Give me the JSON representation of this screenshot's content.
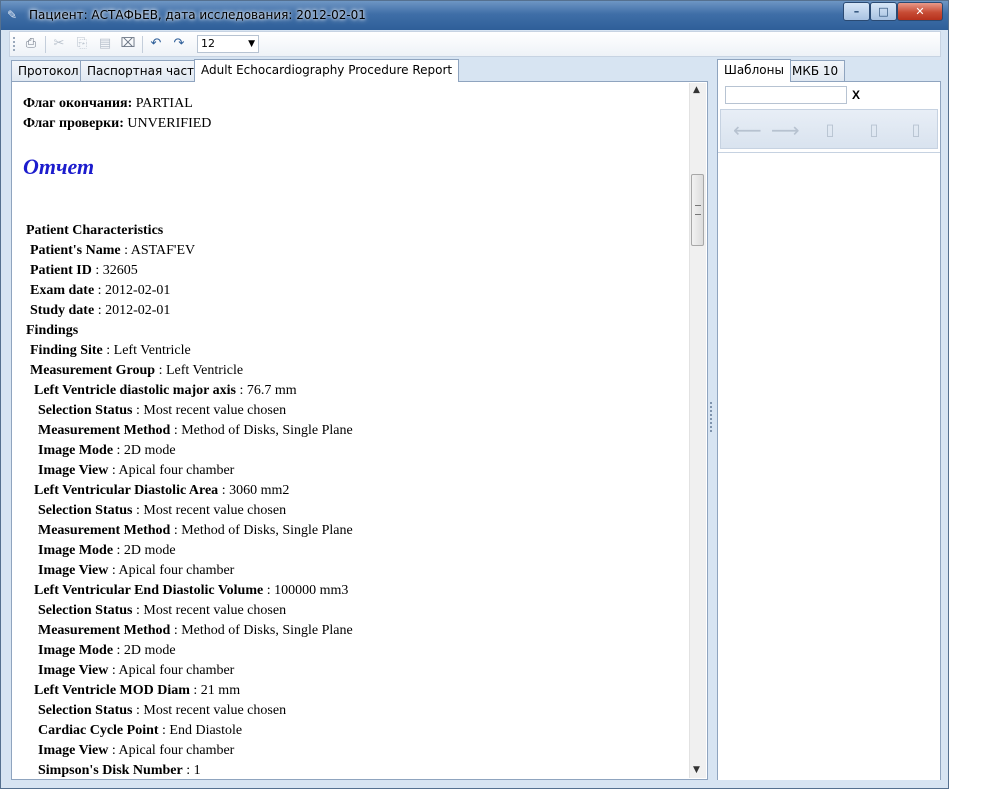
{
  "window": {
    "title": "Пациент: АСТАФЬЕВ, дата исследования: 2012-02-01",
    "minimize": "–",
    "maximize": "□",
    "close": "✕"
  },
  "toolbar": {
    "font_size": "12"
  },
  "tabs": [
    {
      "label": "Протокол",
      "active": false
    },
    {
      "label": "Паспортная часть",
      "active": false
    },
    {
      "label": "Adult Echocardiography Procedure Report",
      "active": true
    }
  ],
  "side_tabs": [
    {
      "label": "Шаблоны",
      "active": true
    },
    {
      "label": "МКБ 10",
      "active": false
    }
  ],
  "side_panel": {
    "search_value": "",
    "clear_label": "X"
  },
  "document": {
    "flags": [
      {
        "label": "Флаг окончания:",
        "value": " PARTIAL"
      },
      {
        "label": "Флаг проверки:",
        "value": " UNVERIFIED"
      }
    ],
    "heading": "Отчет",
    "lines": [
      {
        "label": "Patient Characteristics",
        "value": ""
      },
      {
        "label": "Patient's Name",
        "value": " : ASTAF'EV"
      },
      {
        "label": "Patient ID",
        "value": " : 32605"
      },
      {
        "label": "Exam date",
        "value": " : 2012-02-01"
      },
      {
        "label": "Study date",
        "value": " : 2012-02-01"
      },
      {
        "label": "Findings",
        "value": ""
      },
      {
        "label": "Finding Site",
        "value": " : Left Ventricle"
      },
      {
        "label": "Measurement Group",
        "value": " : Left Ventricle"
      },
      {
        "label": "Left Ventricle diastolic major axis",
        "value": " : 76.7 mm"
      },
      {
        "label": "Selection Status",
        "value": " : Most recent value chosen"
      },
      {
        "label": "Measurement Method",
        "value": " : Method of Disks, Single Plane"
      },
      {
        "label": "Image Mode",
        "value": " : 2D mode"
      },
      {
        "label": "Image View",
        "value": " : Apical four chamber"
      },
      {
        "label": "Left Ventricular Diastolic Area",
        "value": " : 3060 mm2"
      },
      {
        "label": "Selection Status",
        "value": " : Most recent value chosen"
      },
      {
        "label": "Measurement Method",
        "value": " : Method of Disks, Single Plane"
      },
      {
        "label": "Image Mode",
        "value": " : 2D mode"
      },
      {
        "label": "Image View",
        "value": " : Apical four chamber"
      },
      {
        "label": "Left Ventricular End Diastolic Volume",
        "value": " : 100000 mm3"
      },
      {
        "label": "Selection Status",
        "value": " : Most recent value chosen"
      },
      {
        "label": "Measurement Method",
        "value": " : Method of Disks, Single Plane"
      },
      {
        "label": "Image Mode",
        "value": " : 2D mode"
      },
      {
        "label": "Image View",
        "value": " : Apical four chamber"
      },
      {
        "label": "Left Ventricle MOD Diam",
        "value": " : 21 mm"
      },
      {
        "label": "Selection Status",
        "value": " : Most recent value chosen"
      },
      {
        "label": "Cardiac Cycle Point",
        "value": " : End Diastole"
      },
      {
        "label": "Image View",
        "value": " : Apical four chamber"
      },
      {
        "label": "Simpson's Disk Number",
        "value": " : 1"
      }
    ]
  },
  "icons": {
    "app": "app-icon",
    "print_preview": "print-preview-icon",
    "cut": "cut-icon",
    "copy": "copy-icon",
    "paste": "paste-icon",
    "clear_format": "clear-format-icon",
    "undo": "undo-icon",
    "redo": "redo-icon",
    "back": "back-arrow-icon",
    "forward": "forward-arrow-icon",
    "new_template": "new-template-icon",
    "rename_template": "rename-template-icon",
    "delete_template": "delete-template-icon"
  },
  "colors": {
    "report_heading": "#1c1ccd",
    "titlebar": "#3f6ea7",
    "window_frame": "#d7e4f2"
  }
}
